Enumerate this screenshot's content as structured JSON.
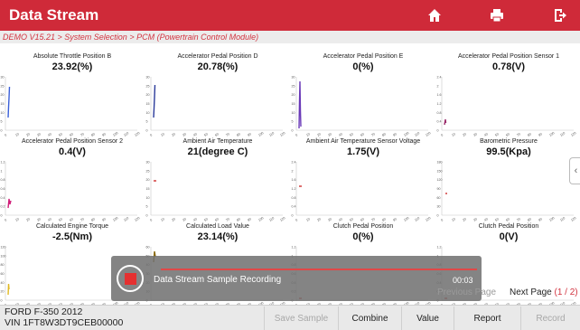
{
  "header": {
    "title": "Data Stream",
    "icons": [
      "home-icon",
      "print-icon",
      "exit-icon"
    ],
    "background": "#cf2a39"
  },
  "breadcrumb": "DEMO V15.21 > System Selection > PCM (Powertrain Control Module)",
  "cells": [
    {
      "title": "Absolute Throttle Position B",
      "value": "23.92(%)",
      "y_ticks": [
        "30",
        "25",
        "20",
        "15",
        "10",
        "5",
        "0"
      ],
      "trace_color": "#3a5fd8"
    },
    {
      "title": "Accelerator Pedal Position D",
      "value": "20.78(%)",
      "y_ticks": [
        "30",
        "25",
        "20",
        "15",
        "10",
        "5",
        "0"
      ],
      "trace_color": "#2a3a9a"
    },
    {
      "title": "Accelerator Pedal Position E",
      "value": "0(%)",
      "y_ticks": [
        "30",
        "25",
        "20",
        "15",
        "10",
        "5",
        "0"
      ],
      "trace_color": "#6a3ab8"
    },
    {
      "title": "Accelerator Pedal Position Sensor 1",
      "value": "0.78(V)",
      "y_ticks": [
        "2.4",
        "2",
        "1.6",
        "1.2",
        "0.8",
        "0.4",
        "0"
      ],
      "trace_color": "#9a2a6a"
    },
    {
      "title": "Accelerator Pedal Position Sensor 2",
      "value": "0.4(V)",
      "y_ticks": [
        "1.2",
        "1",
        "0.8",
        "0.6",
        "0.4",
        "0.2",
        "0"
      ],
      "trace_color": "#d0207a"
    },
    {
      "title": "Ambient Air Temperature",
      "value": "21(degree C)",
      "y_ticks": [
        "30",
        "25",
        "20",
        "15",
        "10",
        "5",
        "0"
      ],
      "trace_color": "#d03030"
    },
    {
      "title": "Ambient Air Temperature Sensor Voltage",
      "value": "1.75(V)",
      "y_ticks": [
        "2.4",
        "2",
        "1.6",
        "1.2",
        "0.8",
        "0.4",
        "0"
      ],
      "trace_color": "#d03030"
    },
    {
      "title": "Barometric Pressure",
      "value": "99.5(Kpa)",
      "y_ticks": [
        "180",
        "150",
        "120",
        "90",
        "60",
        "30",
        "0"
      ],
      "trace_color": "#d03030"
    },
    {
      "title": "Calculated Engine Torque",
      "value": "-2.5(Nm)",
      "y_ticks": [
        "120",
        "100",
        "80",
        "60",
        "40",
        "20",
        "0"
      ],
      "trace_color": "#e0b820"
    },
    {
      "title": "Calculated Load Value",
      "value": "23.14(%)",
      "y_ticks": [
        "60",
        "50",
        "40",
        "30",
        "20",
        "10",
        "0"
      ],
      "trace_color": "#8a6a10"
    },
    {
      "title": "Clutch Pedal Position",
      "value": "0(%)",
      "y_ticks": [
        "1.2",
        "1",
        "0.8",
        "0.6",
        "0.4",
        "0.2",
        "0"
      ],
      "trace_color": "#d03030"
    },
    {
      "title": "Clutch Pedal Position",
      "value": "0(V)",
      "y_ticks": [
        "1.2",
        "1",
        "0.8",
        "0.6",
        "0.4",
        "0.2",
        "0"
      ],
      "trace_color": "#d03030"
    }
  ],
  "x_ticks": [
    "0",
    "10",
    "20",
    "30",
    "40",
    "50",
    "60",
    "70",
    "80",
    "90",
    "100",
    "110",
    "120"
  ],
  "recording": {
    "label": "Data Stream Sample Recording",
    "elapsed": "00:03"
  },
  "pager": {
    "prev_label": "Previous Page",
    "next_label": "Next Page",
    "page_indicator": "(1 / 2)"
  },
  "vehicle": {
    "model": "FORD F-350 2012",
    "vin": "VIN 1FT8W3DT9CEB00000"
  },
  "buttons": [
    {
      "label": "Save Sample",
      "enabled": false
    },
    {
      "label": "Combine",
      "enabled": true
    },
    {
      "label": "Value",
      "enabled": true
    },
    {
      "label": "Report",
      "enabled": true
    },
    {
      "label": "Record",
      "enabled": false
    }
  ]
}
